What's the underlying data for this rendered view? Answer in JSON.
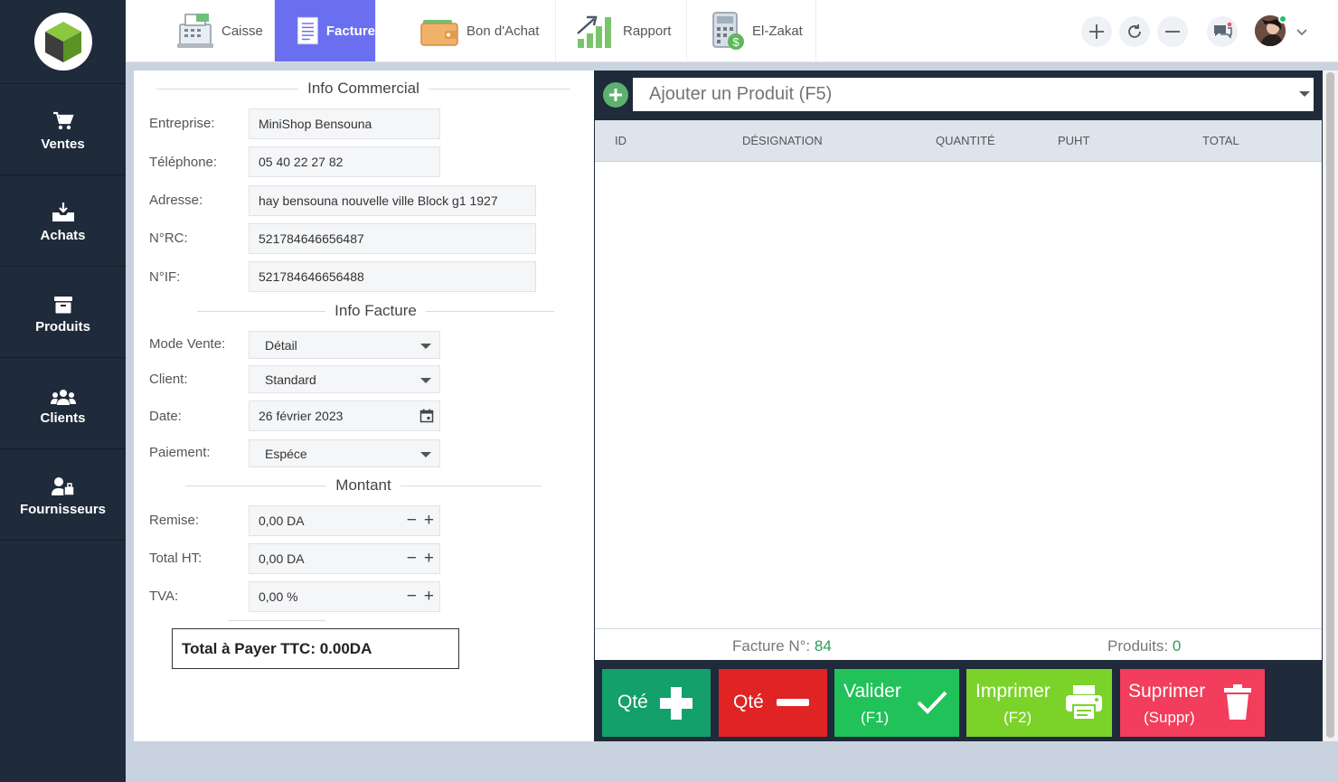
{
  "sidebar": {
    "items": [
      {
        "label": "Ventes",
        "icon": "cart-icon"
      },
      {
        "label": "Achats",
        "icon": "inbox-download-icon"
      },
      {
        "label": "Produits",
        "icon": "box-icon"
      },
      {
        "label": "Clients",
        "icon": "users-icon"
      },
      {
        "label": "Fournisseurs",
        "icon": "supplier-icon"
      }
    ]
  },
  "topbar": {
    "tabs": [
      {
        "label": "Caisse",
        "icon": "cash-register-icon"
      },
      {
        "label": "Facture",
        "icon": "invoice-icon",
        "active": true
      },
      {
        "label": "Bon d'Achat",
        "icon": "wallet-icon"
      },
      {
        "label": "Rapport",
        "icon": "bar-chart-icon"
      },
      {
        "label": "El-Zakat",
        "icon": "calculator-icon"
      }
    ],
    "actions": [
      "plus-icon",
      "refresh-icon",
      "minus-icon",
      "chat-icon"
    ]
  },
  "form": {
    "info_commercial": {
      "title": "Info Commercial",
      "entreprise_label": "Entreprise:",
      "entreprise_value": "MiniShop Bensouna",
      "telephone_label": "Téléphone:",
      "telephone_value": "05 40 22 27 82",
      "adresse_label": "Adresse:",
      "adresse_value": "hay bensouna nouvelle ville Block g1 1927",
      "rc_label": "N°RC:",
      "rc_value": "521784646656487",
      "if_label": "N°IF:",
      "if_value": "521784646656488"
    },
    "info_facture": {
      "title": "Info Facture",
      "mode_label": "Mode Vente:",
      "mode_value": "Détail",
      "client_label": "Client:",
      "client_value": "Standard",
      "date_label": "Date:",
      "date_value": "26 février 2023",
      "paiement_label": "Paiement:",
      "paiement_value": "Espéce"
    },
    "montant": {
      "title": "Montant",
      "remise_label": "Remise:",
      "remise_value": "0,00 DA",
      "total_ht_label": "Total HT:",
      "total_ht_value": "0,00 DA",
      "tva_label": "TVA:",
      "tva_value": "0,00 %"
    },
    "total_ttc": "Total à Payer TTC:  0.00DA"
  },
  "products": {
    "search_placeholder": "Ajouter un Produit (F5)",
    "columns": [
      "ID",
      "DÉSIGNATION",
      "QUANTITÉ",
      "PUHT",
      "TOTAL"
    ],
    "rows": [],
    "facture_label": "Facture N°:",
    "facture_number": "84",
    "produits_label": "Produits:",
    "produits_count": "0"
  },
  "actions": {
    "qte_plus": "Qté",
    "qte_minus": "Qté",
    "valider": "Valider",
    "valider_key": "(F1)",
    "imprimer": "Imprimer",
    "imprimer_key": "(F2)",
    "suprimer": "Suprimer",
    "suprimer_key": "(Suppr)"
  },
  "colors": {
    "sidebar_bg": "#1f2a3a",
    "active_tab": "#6a6ff0",
    "qte_plus": "#13a06a",
    "qte_minus": "#e02424",
    "valider": "#21c25a",
    "imprimer": "#7bd32a",
    "suprimer": "#f23d5c"
  }
}
